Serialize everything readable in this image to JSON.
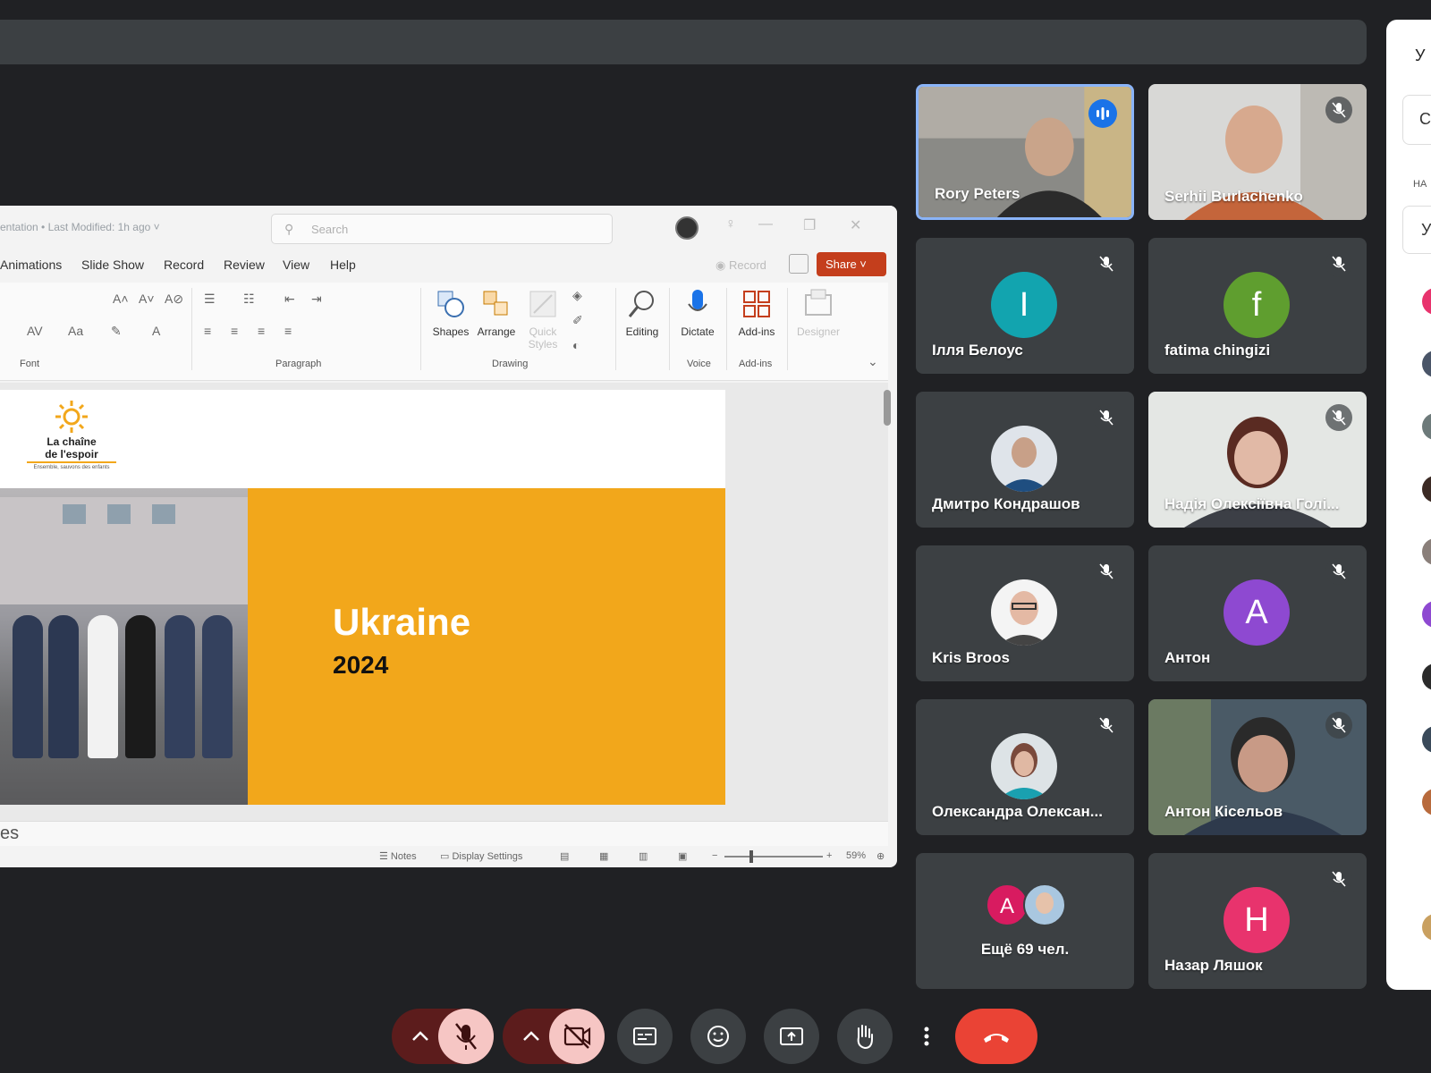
{
  "ppt": {
    "doc_title": "entation • Last Modified: 1h ago ˅",
    "search_placeholder": "Search",
    "menu": [
      "Animations",
      "Slide Show",
      "Record",
      "Review",
      "View",
      "Help"
    ],
    "record_label": "Record",
    "share_label": "Share ˅",
    "ribbon": {
      "groups": [
        "Font",
        "Paragraph",
        "Drawing",
        "Voice",
        "Add-ins"
      ],
      "buttons": [
        "Shapes",
        "Arrange",
        "Quick Styles",
        "Editing",
        "Dictate",
        "Add-ins",
        "Designer"
      ]
    },
    "slide": {
      "logo_line1": "La chaîne",
      "logo_line2": "de l'espoir",
      "logo_tagline": "Ensemble, sauvons des enfants",
      "title": "Ukraine",
      "year": "2024"
    },
    "notes_text": "es",
    "status": {
      "notes": "Notes",
      "display_settings": "Display Settings",
      "zoom": "59%"
    }
  },
  "participants": [
    {
      "name": "Rory Peters",
      "kind": "video",
      "speaking": true
    },
    {
      "name": "Serhii Burlachenko",
      "kind": "video",
      "muted": true
    },
    {
      "name": "Ілля Белоус",
      "kind": "letter",
      "letter": "I",
      "color": "#12a4af",
      "muted": true
    },
    {
      "name": "fatima chingizi",
      "kind": "letter",
      "letter": "f",
      "color": "#5f9e2f",
      "muted": true
    },
    {
      "name": "Дмитро Кондрашов",
      "kind": "avatar",
      "muted": true
    },
    {
      "name": "Надія Олексіївна Голі...",
      "kind": "video",
      "muted": true
    },
    {
      "name": "Kris Broos",
      "kind": "avatar",
      "muted": true
    },
    {
      "name": "Антон",
      "kind": "letter",
      "letter": "A",
      "color": "#8e49d1",
      "muted": true
    },
    {
      "name": "Олександра Олексан...",
      "kind": "avatar",
      "muted": true
    },
    {
      "name": "Антон Кісельов",
      "kind": "video",
      "muted": true
    },
    {
      "name": "Ещё 69 чел.",
      "kind": "more",
      "letter": "A",
      "color": "#d81b60"
    },
    {
      "name": "Назар Ляшок",
      "kind": "letter",
      "letter": "H",
      "color": "#e8336d",
      "muted": true
    }
  ],
  "side_panel": {
    "header": "У",
    "search_letter": "С",
    "section_label": "НА",
    "row_letter": "У"
  },
  "controls": [
    "mic-options",
    "mic-off",
    "camera-options",
    "camera-off",
    "captions",
    "reactions",
    "present",
    "raise-hand",
    "more-options",
    "leave-call"
  ],
  "colors": {
    "end_call": "#ea4335",
    "muted_bg": "#f6c6c4",
    "accent_orange": "#f2a71b"
  }
}
